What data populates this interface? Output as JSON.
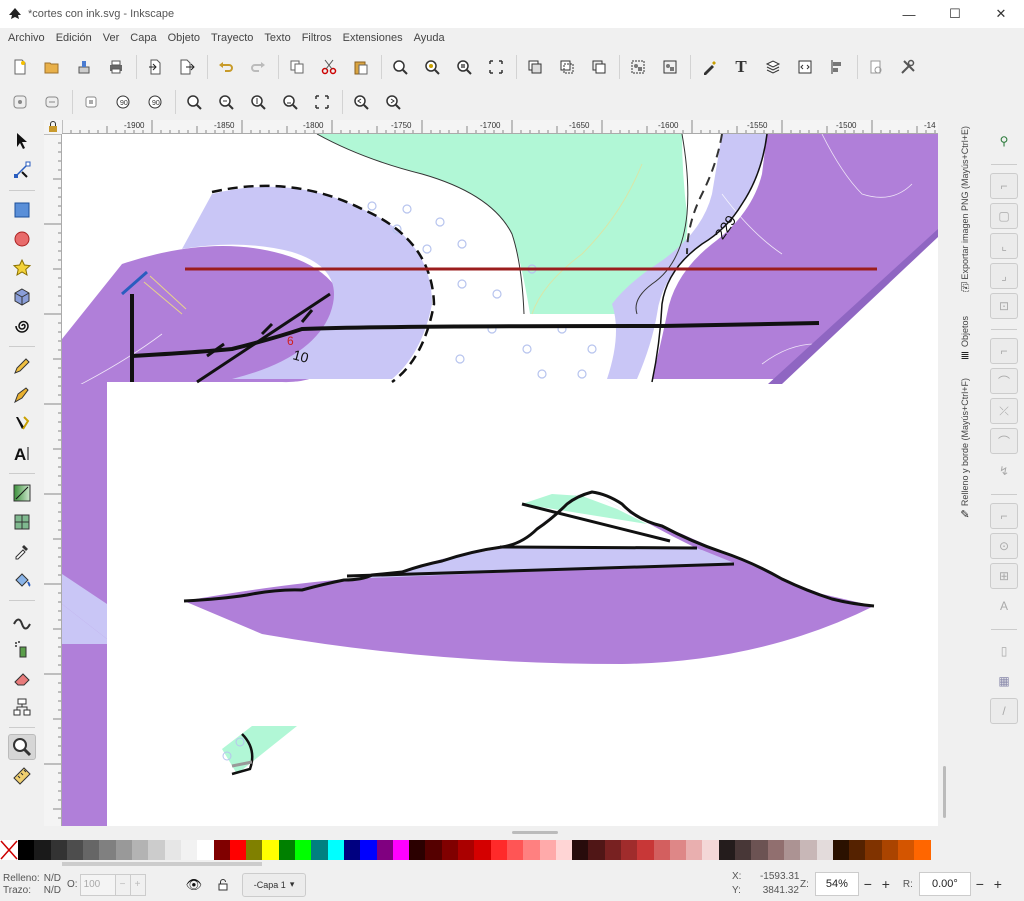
{
  "window": {
    "title": "*cortes con ink.svg - Inkscape",
    "minimize": "—",
    "maximize": "☐",
    "close": "✕"
  },
  "menu": [
    "Archivo",
    "Edición",
    "Ver",
    "Capa",
    "Objeto",
    "Trayecto",
    "Texto",
    "Filtros",
    "Extensiones",
    "Ayuda"
  ],
  "ruler": {
    "top_labels": [
      "-1900",
      "-1850",
      "-1800",
      "-1750",
      "-1700",
      "-1650",
      "-1600",
      "-1550",
      "-1500",
      "-14"
    ]
  },
  "map": {
    "contour_label_1": "229",
    "contour_label_2": "10",
    "marker_label": "6"
  },
  "dock": {
    "tab_export": "Exportar imagen PNG (Mayús+Ctrl+E)",
    "tab_objects": "Objetos",
    "tab_fill": "Relleno y borde (Mayús+Ctrl+F)"
  },
  "palette": [
    "#000000",
    "#1a1a1a",
    "#333333",
    "#4d4d4d",
    "#666666",
    "#808080",
    "#999999",
    "#b3b3b3",
    "#cccccc",
    "#e6e6e6",
    "#f2f2f2",
    "#ffffff",
    "#800000",
    "#ff0000",
    "#808000",
    "#ffff00",
    "#008000",
    "#00ff00",
    "#008080",
    "#00ffff",
    "#000080",
    "#0000ff",
    "#800080",
    "#ff00ff",
    "#2b0000",
    "#550000",
    "#800000",
    "#aa0000",
    "#d40000",
    "#ff2a2a",
    "#ff5555",
    "#ff8080",
    "#ffaaaa",
    "#ffd5d5",
    "#280b0b",
    "#501616",
    "#782121",
    "#a02c2c",
    "#c83737",
    "#d35f5f",
    "#de8787",
    "#e9afaf",
    "#f4d7d7",
    "#241c1c",
    "#483737",
    "#6c5353",
    "#916f6f",
    "#ac9393",
    "#c8b7b7",
    "#e3dbdb",
    "#2b1100",
    "#552200",
    "#803300",
    "#aa4400",
    "#d45500",
    "#ff6600"
  ],
  "status": {
    "fill_label": "Relleno:",
    "fill_value": "N/D",
    "stroke_label": "Trazo:",
    "stroke_value": "N/D",
    "opacity_label": "O:",
    "opacity_value": "100",
    "layer": "-Capa 1",
    "x_label": "X:",
    "x_value": "-1593.31",
    "y_label": "Y:",
    "y_value": "3841.32",
    "zoom_label": "Z:",
    "zoom_value": "54%",
    "rotate_label": "R:",
    "rotate_value": "0.00°"
  }
}
